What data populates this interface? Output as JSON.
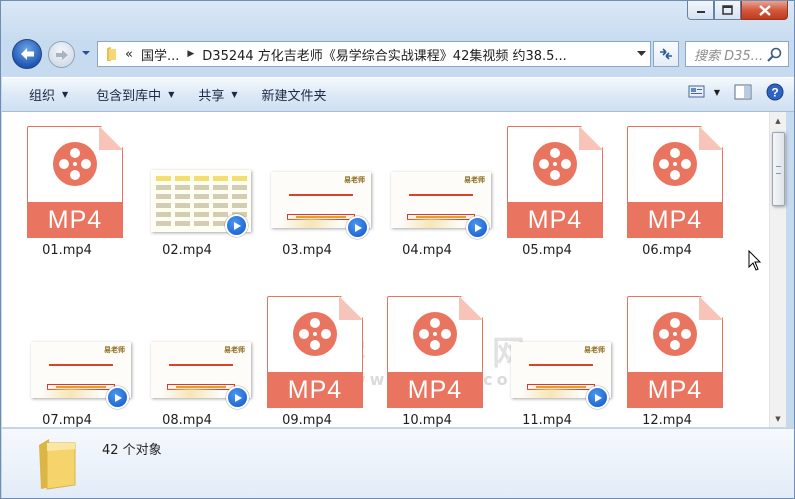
{
  "window": {
    "address_segments": [
      "«",
      "国学...",
      "D35244 方化吉老师《易学综合实战课程》42集视频 约38.5..."
    ],
    "search_placeholder": "搜索 D35..."
  },
  "commands": {
    "organize": "组织",
    "include_library": "包含到库中",
    "share": "共享",
    "new_folder": "新建文件夹"
  },
  "files": [
    {
      "name": "01.mp4",
      "kind": "mp4-icon"
    },
    {
      "name": "02.mp4",
      "kind": "video-thumb-table"
    },
    {
      "name": "03.mp4",
      "kind": "video-thumb"
    },
    {
      "name": "04.mp4",
      "kind": "video-thumb"
    },
    {
      "name": "05.mp4",
      "kind": "mp4-icon"
    },
    {
      "name": "06.mp4",
      "kind": "mp4-icon"
    },
    {
      "name": "07.mp4",
      "kind": "video-thumb"
    },
    {
      "name": "08.mp4",
      "kind": "video-thumb"
    },
    {
      "name": "09.mp4",
      "kind": "mp4-icon"
    },
    {
      "name": "10.mp4",
      "kind": "mp4-icon"
    },
    {
      "name": "11.mp4",
      "kind": "video-thumb"
    },
    {
      "name": "12.mp4",
      "kind": "mp4-icon"
    }
  ],
  "mp4_badge": "MP4",
  "thumb_logo": "易老师",
  "watermark": {
    "line1": "国学资源网",
    "line2": "www.95959.com"
  },
  "status": {
    "count": "42 个对象"
  },
  "colors": {
    "mp4_accent": "#e9745f",
    "address_border": "#8ea6c6"
  }
}
